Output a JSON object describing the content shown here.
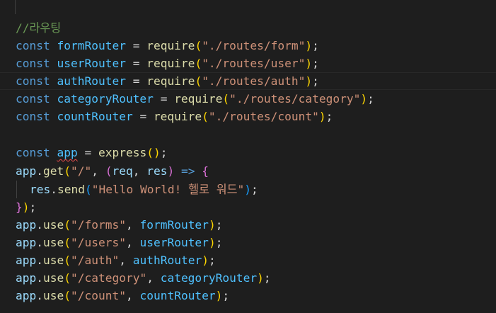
{
  "code": {
    "comment": "//라우팅",
    "requires": [
      {
        "keyword": "const",
        "name": "formRouter",
        "op": "=",
        "fn": "require",
        "open": "(",
        "path": "\"./routes/form\"",
        "close": ")",
        "semi": ";"
      },
      {
        "keyword": "const",
        "name": "userRouter",
        "op": "=",
        "fn": "require",
        "open": "(",
        "path": "\"./routes/user\"",
        "close": ")",
        "semi": ";"
      },
      {
        "keyword": "const",
        "name": "authRouter",
        "op": "=",
        "fn": "require",
        "open": "(",
        "path": "\"./routes/auth\"",
        "close": ")",
        "semi": ";"
      },
      {
        "keyword": "const",
        "name": "categoryRouter",
        "op": "=",
        "fn": "require",
        "open": "(",
        "path": "\"./routes/category\"",
        "close": ")",
        "semi": ";"
      },
      {
        "keyword": "const",
        "name": "countRouter",
        "op": "=",
        "fn": "require",
        "open": "(",
        "path": "\"./routes/count\"",
        "close": ")",
        "semi": ";"
      }
    ],
    "app_decl": {
      "keyword": "const",
      "name": "app",
      "op": "=",
      "fn": "express",
      "parens": "()",
      "semi": ";"
    },
    "get_route": {
      "obj": "app",
      "dot": ".",
      "method": "get",
      "open": "(",
      "path": "\"/\"",
      "comma": ", ",
      "params_open": "(",
      "param1": "req",
      "param_comma": ", ",
      "param2": "res",
      "params_close": ")",
      "arrow": " => ",
      "brace_open": "{",
      "body_obj": "res",
      "body_method": "send",
      "body_open": "(",
      "body_str": "\"Hello World! 헬로 워드\"",
      "body_close": ")",
      "body_semi": ";",
      "brace_close": "}",
      "close": ")",
      "semi": ";"
    },
    "use_routes": [
      {
        "obj": "app",
        "method": "use",
        "open": "(",
        "path": "\"/forms\"",
        "comma": ", ",
        "router": "formRouter",
        "close": ")",
        "semi": ";"
      },
      {
        "obj": "app",
        "method": "use",
        "open": "(",
        "path": "\"/users\"",
        "comma": ", ",
        "router": "userRouter",
        "close": ")",
        "semi": ";"
      },
      {
        "obj": "app",
        "method": "use",
        "open": "(",
        "path": "\"/auth\"",
        "comma": ", ",
        "router": "authRouter",
        "close": ")",
        "semi": ";"
      },
      {
        "obj": "app",
        "method": "use",
        "open": "(",
        "path": "\"/category\"",
        "comma": ", ",
        "router": "categoryRouter",
        "close": ")",
        "semi": ";"
      },
      {
        "obj": "app",
        "method": "use",
        "open": "(",
        "path": "\"/count\"",
        "comma": ", ",
        "router": "countRouter",
        "close": ")",
        "semi": ";"
      }
    ]
  },
  "colors": {
    "background": "#1e1e1e",
    "comment": "#6a9955",
    "keyword": "#569cd6",
    "constant": "#4fc1ff",
    "variable": "#9cdcfe",
    "function": "#dcdcaa",
    "string": "#ce9178",
    "bracket_level1": "#ffd700",
    "bracket_level2": "#da70d6",
    "bracket_level3": "#179fff",
    "error_squiggle": "#f14c4c"
  }
}
